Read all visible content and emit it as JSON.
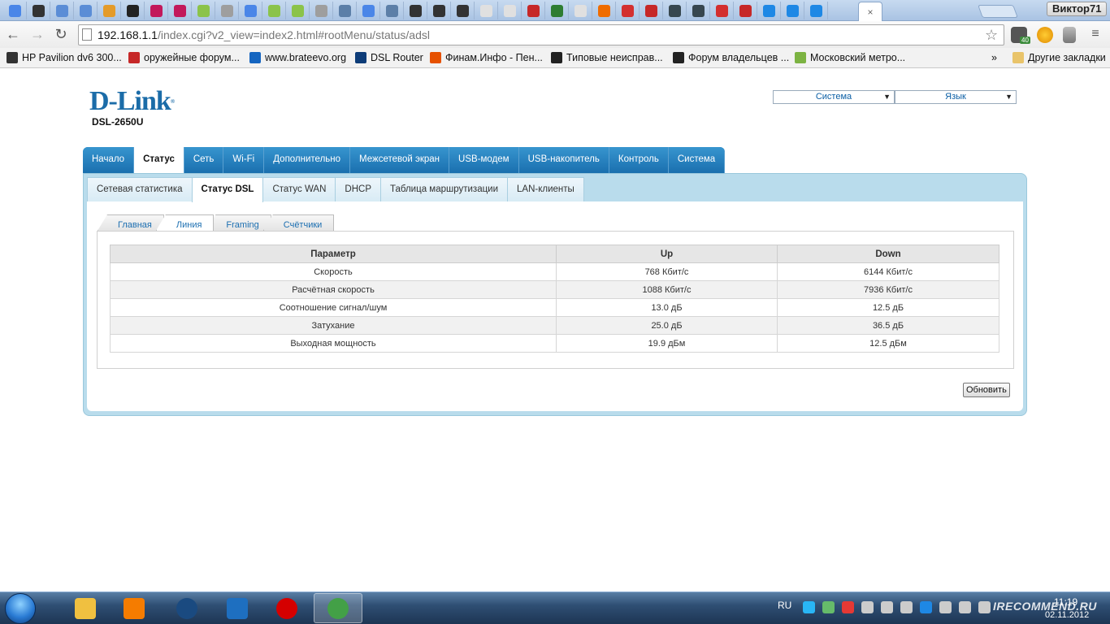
{
  "browser": {
    "profile_name": "Виктор71",
    "tab_close_glyph": "×",
    "url_host": "192.168.1.1",
    "url_rest": "/index.cgi?v2_view=index2.html#rootMenu/status/adsl",
    "ext_badge": "40",
    "favicon_colors": [
      "#4a86e8",
      "#333333",
      "#5b8dd6",
      "#5b8dd6",
      "#e49b2a",
      "#222222",
      "#c2185b",
      "#c2185b",
      "#8bc34a",
      "#9e9e9e",
      "#4a86e8",
      "#8bc34a",
      "#8bc34a",
      "#9e9e9e",
      "#5c7fa8",
      "#4a86e8",
      "#5c7fa8",
      "#333333",
      "#333333",
      "#333333",
      "#e0e0e0",
      "#e0e0e0",
      "#c62828",
      "#2e7d32",
      "#e0e0e0",
      "#ef6c00",
      "#d32f2f",
      "#c62828",
      "#37474f",
      "#37474f",
      "#d32f2f",
      "#c62828",
      "#1e88e5",
      "#1e88e5",
      "#1e88e5"
    ],
    "bookmarks": [
      {
        "label": "HP Pavilion dv6 300...",
        "color": "#333333"
      },
      {
        "label": "оружейные форум...",
        "color": "#c62828"
      },
      {
        "label": "www.brateevo.org",
        "color": "#1565c0"
      },
      {
        "label": "DSL Router",
        "color": "#0d3c78"
      },
      {
        "label": "Финам.Инфо - Пен...",
        "color": "#e65100"
      },
      {
        "label": "Типовые неисправ...",
        "color": "#222222"
      },
      {
        "label": "Форум владельцев ...",
        "color": "#222222"
      },
      {
        "label": "Московский метро...",
        "color": "#7cb342"
      }
    ],
    "bookmarks_more": "»",
    "other_bookmarks": "Другие закладки"
  },
  "header": {
    "logo": "D-Link",
    "logo_mark": "®",
    "model": "DSL-2650U",
    "system_select": "Система",
    "language_select": "Язык"
  },
  "main_menu": [
    {
      "label": "Начало",
      "active": false
    },
    {
      "label": "Статус",
      "active": true
    },
    {
      "label": "Сеть",
      "active": false
    },
    {
      "label": "Wi-Fi",
      "active": false
    },
    {
      "label": "Дополнительно",
      "active": false
    },
    {
      "label": "Межсетевой экран",
      "active": false
    },
    {
      "label": "USB-модем",
      "active": false
    },
    {
      "label": "USB-накопитель",
      "active": false
    },
    {
      "label": "Контроль",
      "active": false
    },
    {
      "label": "Система",
      "active": false
    }
  ],
  "sub_menu": [
    {
      "label": "Сетевая статистика",
      "active": false
    },
    {
      "label": "Статус DSL",
      "active": true
    },
    {
      "label": "Статус WAN",
      "active": false
    },
    {
      "label": "DHCP",
      "active": false
    },
    {
      "label": "Таблица маршрутизации",
      "active": false
    },
    {
      "label": "LAN-клиенты",
      "active": false
    }
  ],
  "inner_tabs": [
    {
      "label": "Главная",
      "active": false
    },
    {
      "label": "Линия",
      "active": true
    },
    {
      "label": "Framing",
      "active": false
    },
    {
      "label": "Счётчики",
      "active": false
    }
  ],
  "table": {
    "headers": [
      "Параметр",
      "Up",
      "Down"
    ],
    "rows": [
      [
        "Скорость",
        "768 Кбит/с",
        "6144 Кбит/с"
      ],
      [
        "Расчётная скорость",
        "1088 Кбит/с",
        "7936 Кбит/с"
      ],
      [
        "Соотношение сигнал/шум",
        "13.0 дБ",
        "12.5 дБ"
      ],
      [
        "Затухание",
        "25.0 дБ",
        "36.5 дБ"
      ],
      [
        "Выходная мощность",
        "19.9 дБм",
        "12.5 дБм"
      ]
    ]
  },
  "refresh_button": "Обновить",
  "taskbar": {
    "apps": [
      {
        "name": "explorer",
        "color": "#f0c040"
      },
      {
        "name": "media-player",
        "color": "#f57c00"
      },
      {
        "name": "hp-app",
        "color": "#1a4a80"
      },
      {
        "name": "check-app",
        "color": "#1e6fc0"
      },
      {
        "name": "opera",
        "color": "#d50000"
      },
      {
        "name": "chrome",
        "color": "#43a047"
      }
    ],
    "active_app": 5,
    "language": "RU",
    "tray_colors": [
      "#29b6f6",
      "#66bb6a",
      "#e53935",
      "#cccccc",
      "#cccccc",
      "#cccccc",
      "#1e88e5",
      "#cccccc",
      "#cccccc",
      "#cccccc"
    ],
    "time": "11:19",
    "date": "02.11.2012",
    "watermark": "IRECOMMEND.RU"
  }
}
